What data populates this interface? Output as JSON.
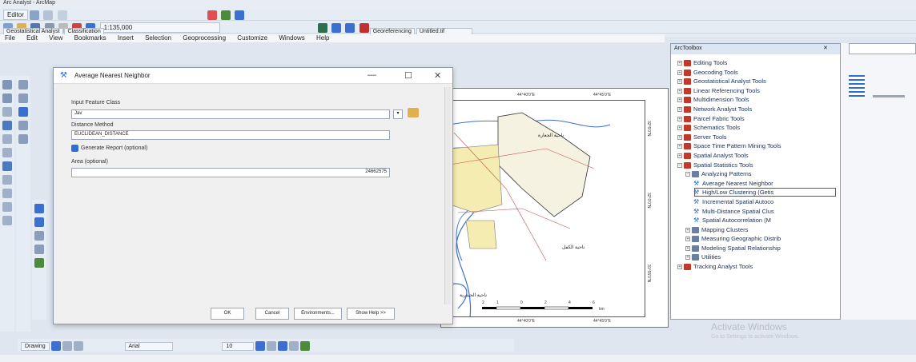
{
  "window": {
    "title": "Arc Analyst - ArcMap"
  },
  "toolbars": {
    "editor_label": "Editor",
    "scale_value": "1:135,000",
    "geostat_label": "Geostatistical Analyst",
    "classification_label": "Classification",
    "georef_label": "Georeferencing",
    "georef_value": "Untitled.tif"
  },
  "menu": [
    "File",
    "Edit",
    "View",
    "Bookmarks",
    "Insert",
    "Selection",
    "Geoprocessing",
    "Customize",
    "Windows",
    "Help"
  ],
  "dialog": {
    "title": "Average Nearest Neighbor",
    "input_label": "Input Feature Class",
    "input_value": "Jav",
    "distance_label": "Distance Method",
    "distance_value": "EUCLIDEAN_DISTANCE",
    "report_label": "Generate Report (optional)",
    "area_label": "Area (optional)",
    "area_value": "24662575",
    "buttons": {
      "ok": "OK",
      "cancel": "Cancel",
      "env": "Environments...",
      "help": "Show Help >>"
    }
  },
  "map": {
    "top_coords": [
      "44°40'0\"E",
      "44°45'0\"E"
    ],
    "bottom_coords": [
      "44°40'0\"E",
      "44°45'0\"E"
    ],
    "side_coords": [
      "32°5'0\"N",
      "32°0'0\"N",
      "31°55'0\"N"
    ],
    "scale_numbers": [
      "2",
      "1",
      "0",
      "2",
      "4",
      "6"
    ],
    "scale_unit": "km",
    "place_labels": [
      "ناحية الكفل",
      "ناحية الحيدرية",
      "ناحية الجعارة"
    ]
  },
  "toolbox": {
    "title": "ArcToolbox",
    "tools": [
      {
        "label": "Editing Tools",
        "level": 0
      },
      {
        "label": "Geocoding Tools",
        "level": 0
      },
      {
        "label": "Geostatistical Analyst Tools",
        "level": 0
      },
      {
        "label": "Linear Referencing Tools",
        "level": 0
      },
      {
        "label": "Multidimension Tools",
        "level": 0
      },
      {
        "label": "Network Analyst Tools",
        "level": 0
      },
      {
        "label": "Parcel Fabric Tools",
        "level": 0
      },
      {
        "label": "Schematics Tools",
        "level": 0
      },
      {
        "label": "Server Tools",
        "level": 0
      },
      {
        "label": "Space Time Pattern Mining Tools",
        "level": 0
      },
      {
        "label": "Spatial Analyst Tools",
        "level": 0
      },
      {
        "label": "Spatial Statistics Tools",
        "level": 0
      },
      {
        "label": "Analyzing Patterns",
        "level": 1
      },
      {
        "label": "Average Nearest Neighbor",
        "level": 2
      },
      {
        "label": "High/Low Clustering (Getis",
        "level": 2
      },
      {
        "label": "Incremental Spatial Autoco",
        "level": 2
      },
      {
        "label": "Multi-Distance Spatial Clus",
        "level": 2
      },
      {
        "label": "Spatial Autocorrelation (M",
        "level": 2
      },
      {
        "label": "Mapping Clusters",
        "level": 1
      },
      {
        "label": "Measuring Geographic Distrib",
        "level": 1
      },
      {
        "label": "Modeling Spatial Relationship",
        "level": 1
      },
      {
        "label": "Utilities",
        "level": 1
      },
      {
        "label": "Tracking Analyst Tools",
        "level": 0
      }
    ]
  },
  "drawing": {
    "label": "Drawing",
    "font": "Arial",
    "size": "10"
  },
  "watermark": {
    "line1": "Activate Windows",
    "line2": "Go to Settings to activate Windows."
  },
  "colors": {
    "highlight": "#d9232d",
    "toolbox_icon": "#c0392b",
    "water": "#3b6fd0",
    "urban": "#f4ecb0"
  }
}
